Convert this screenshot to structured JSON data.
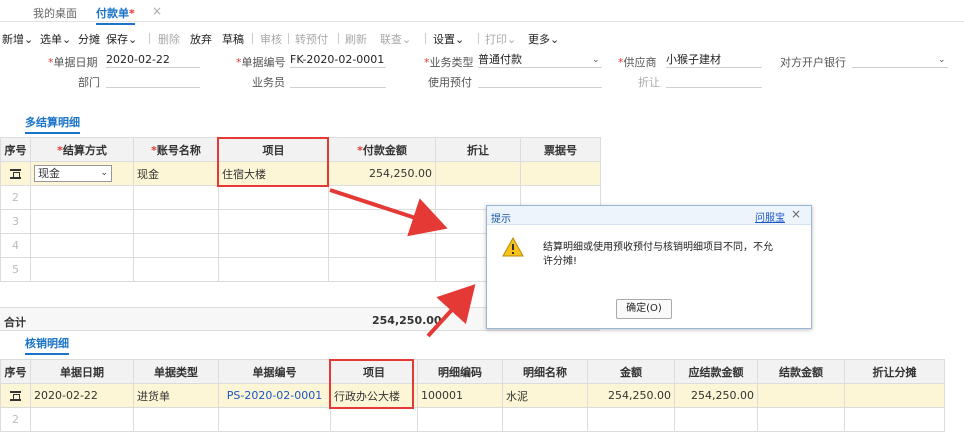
{
  "tabs": {
    "home": "我的桌面",
    "active": "付款单",
    "active_star": "*",
    "close": "×"
  },
  "toolbar": {
    "add": "新增",
    "select_doc": "选单",
    "split": "分摊",
    "save": "保存",
    "delete": "删除",
    "abandon": "放弃",
    "draft": "草稿",
    "audit": "审核",
    "to_prepay": "转预付",
    "refresh": "刷新",
    "query": "联查",
    "settings": "设置",
    "print": "打印",
    "more": "更多",
    "caret": "⌄"
  },
  "form": {
    "doc_date_label": "单据日期",
    "doc_date": "2020-02-22",
    "doc_no_label": "单据编号",
    "doc_no": "FK-2020-02-0001",
    "biz_type_label": "业务类型",
    "biz_type": "普通付款",
    "supplier_label": "供应商",
    "supplier": "小猴子建材",
    "bank_label": "对方开户银行",
    "bank": "",
    "dept_label": "部门",
    "dept": "",
    "clerk_label": "业务员",
    "clerk": "",
    "use_prepay_label": "使用预付",
    "use_prepay": "",
    "discount_label": "折让",
    "discount": ""
  },
  "settlement": {
    "title": "多结算明细",
    "headers": [
      "序号",
      "结算方式",
      "账号名称",
      "项目",
      "付款金额",
      "折让",
      "票据号"
    ],
    "row1": {
      "method": "现金",
      "account": "现金",
      "project": "住宿大楼",
      "amount": "254,250.00",
      "discount": "",
      "bill_no": ""
    },
    "idx": [
      "2",
      "3",
      "4",
      "5"
    ],
    "total_label": "合计",
    "total_amount": "254,250.00"
  },
  "verify": {
    "title": "核销明细",
    "headers": [
      "序号",
      "单据日期",
      "单据类型",
      "单据编号",
      "项目",
      "明细编码",
      "明细名称",
      "金额",
      "应结款金额",
      "结款金额",
      "折让分摊"
    ],
    "row1": {
      "date": "2020-02-22",
      "type": "进货单",
      "doc_no": "PS-2020-02-0001",
      "project": "行政办公大楼",
      "code": "100001",
      "name": "水泥",
      "amount": "254,250.00",
      "due": "254,250.00",
      "settled": "",
      "disc": ""
    },
    "idx2": "2"
  },
  "dialog": {
    "title": "提示",
    "help": "问服宝",
    "close": "×",
    "message_line1": "结算明细或使用预收预付与核销明细项目不同，不允",
    "message_line2": "许分摊!",
    "ok": "确定(O)"
  },
  "colors": {
    "accent": "#1a73c8",
    "highlight": "#e53935",
    "selected_row": "#fdf6d6"
  }
}
